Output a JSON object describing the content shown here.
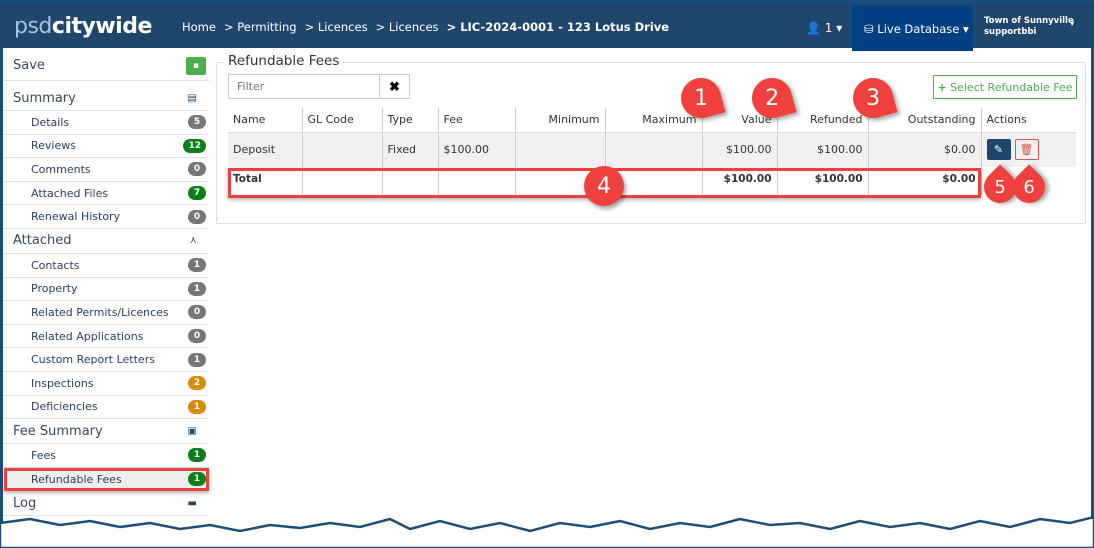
{
  "header": {
    "logo_psd": "psd",
    "logo_citywide": "citywide",
    "breadcrumbs": [
      "Home",
      "> Permitting",
      "> Licences",
      "> Licences",
      "> LIC-2024-0001 - 123 Lotus Drive"
    ],
    "users_count": "1",
    "database": "Live Database",
    "org": "Town of Sunnyville",
    "user": "supportbbi"
  },
  "sidebar": {
    "save": "Save",
    "sections": [
      {
        "label": "Summary",
        "icon": "table-icon",
        "items": [
          {
            "label": "Details",
            "count": "5",
            "color": "gray"
          },
          {
            "label": "Reviews",
            "count": "12",
            "color": "green"
          },
          {
            "label": "Comments",
            "count": "0",
            "color": "gray"
          },
          {
            "label": "Attached Files",
            "count": "7",
            "color": "green"
          },
          {
            "label": "Renewal History",
            "count": "0",
            "color": "gray"
          }
        ]
      },
      {
        "label": "Attached",
        "icon": "sitemap-icon",
        "items": [
          {
            "label": "Contacts",
            "count": "1",
            "color": "gray"
          },
          {
            "label": "Property",
            "count": "1",
            "color": "gray"
          },
          {
            "label": "Related Permits/Licences",
            "count": "0",
            "color": "gray"
          },
          {
            "label": "Related Applications",
            "count": "0",
            "color": "gray"
          },
          {
            "label": "Custom Report Letters",
            "count": "1",
            "color": "gray"
          },
          {
            "label": "Inspections",
            "count": "2",
            "color": "orange"
          },
          {
            "label": "Deficiencies",
            "count": "1",
            "color": "orange"
          }
        ]
      },
      {
        "label": "Fee Summary",
        "icon": "money-icon",
        "items": [
          {
            "label": "Fees",
            "count": "1",
            "color": "green"
          },
          {
            "label": "Refundable Fees",
            "count": "1",
            "color": "green",
            "selected": true
          }
        ]
      },
      {
        "label": "Log",
        "icon": "list-icon",
        "items": []
      }
    ]
  },
  "main": {
    "title": "Refundable Fees",
    "filter_placeholder": "Filter",
    "select_button": "Select Refundable Fee",
    "columns": [
      "Name",
      "GL Code",
      "Type",
      "Fee",
      "Minimum",
      "Maximum",
      "Value",
      "Refunded",
      "Outstanding",
      "Actions"
    ],
    "rows": [
      {
        "name": "Deposit",
        "gl_code": "",
        "type": "Fixed",
        "fee": "$100.00",
        "minimum": "",
        "maximum": "",
        "value": "$100.00",
        "refunded": "$100.00",
        "outstanding": "$0.00"
      }
    ],
    "total": {
      "label": "Total",
      "value": "$100.00",
      "refunded": "$100.00",
      "outstanding": "$0.00"
    }
  },
  "callouts": [
    "1",
    "2",
    "3",
    "4",
    "5",
    "6"
  ],
  "colors": {
    "header": "#1f476d",
    "accent_green": "#4cae4c",
    "callout": "#f0403e"
  }
}
